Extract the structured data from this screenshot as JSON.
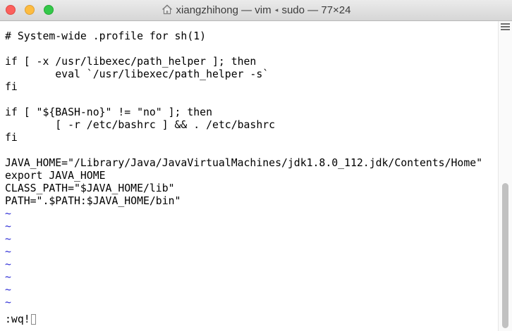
{
  "window": {
    "title_user": "xiangzhihong",
    "title_sep1": " — ",
    "title_cmd1": "vim",
    "title_arrow": "◂",
    "title_cmd2": "sudo",
    "title_sep2": " — ",
    "title_size": "77×24"
  },
  "editor": {
    "lines": [
      "# System-wide .profile for sh(1)",
      "",
      "if [ -x /usr/libexec/path_helper ]; then",
      "        eval `/usr/libexec/path_helper -s`",
      "fi",
      "",
      "if [ \"${BASH-no}\" != \"no\" ]; then",
      "        [ -r /etc/bashrc ] && . /etc/bashrc",
      "fi",
      "",
      "JAVA_HOME=\"/Library/Java/JavaVirtualMachines/jdk1.8.0_112.jdk/Contents/Home\"",
      "export JAVA_HOME",
      "CLASS_PATH=\"$JAVA_HOME/lib\"",
      "PATH=\".$PATH:$JAVA_HOME/bin\""
    ],
    "empty_marker": "~",
    "command_line": ":wq!"
  },
  "colors": {
    "tilde": "#2f2fd6",
    "close": "#fc605c",
    "minimize": "#fdbc40",
    "maximize": "#34c84a"
  },
  "icons": {
    "title": "home-icon",
    "scroll": "scroll-grip-icon"
  }
}
